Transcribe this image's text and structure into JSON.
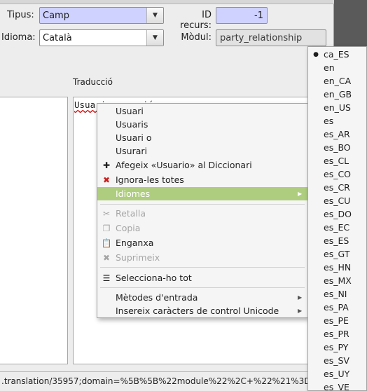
{
  "form": {
    "tipus_label": "Tipus:",
    "tipus_value": "Camp",
    "id_recurs_label": "ID recurs:",
    "id_recurs_value": "-1",
    "idioma_label": "Idioma:",
    "idioma_value": "Català",
    "modul_label": "Mòdul:",
    "modul_value": "party_relationship"
  },
  "columns": {
    "traduccio_header": "Traducció"
  },
  "editor": {
    "translation_text": "Usuario creació"
  },
  "context_menu": {
    "suggestions": [
      "Usuari",
      "Usuaris",
      "Usuari o",
      "Usurari"
    ],
    "add_to_dictionary": "Afegeix «Usuario» al Diccionari",
    "ignore_all": "Ignora-les totes",
    "languages": "Idiomes",
    "cut": "Retalla",
    "copy": "Copia",
    "paste": "Enganxa",
    "delete": "Suprimeix",
    "select_all": "Selecciona-ho tot",
    "input_methods": "Mètodes d'entrada",
    "insert_unicode": "Insereix caràcters de control Unicode"
  },
  "languages_submenu": {
    "selected": "ca_ES",
    "items": [
      "ca_ES",
      "en",
      "en_CA",
      "en_GB",
      "en_US",
      "es",
      "es_AR",
      "es_BO",
      "es_CL",
      "es_CO",
      "es_CR",
      "es_CU",
      "es_DO",
      "es_EC",
      "es_ES",
      "es_GT",
      "es_HN",
      "es_MX",
      "es_NI",
      "es_PA",
      "es_PE",
      "es_PR",
      "es_PY",
      "es_SV",
      "es_UY",
      "es_VE"
    ]
  },
  "statusbar": {
    "url": ".translation/35957;domain=%5B%5B%22module%22%2C+%22%21%3D"
  },
  "colors": {
    "required_field": "#cfd2ff",
    "menu_highlight": "#aecd7e",
    "spell_error": "#d00000",
    "delete_red": "#cc2020"
  }
}
